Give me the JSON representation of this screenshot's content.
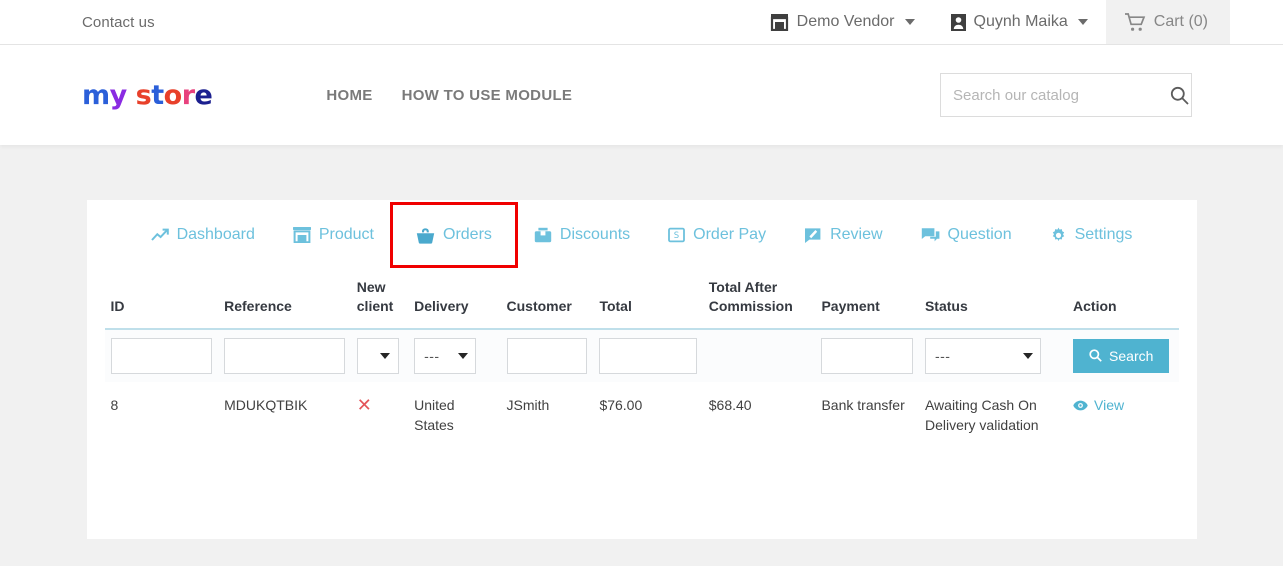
{
  "topbar": {
    "contact": "Contact us",
    "vendor": "Demo Vendor",
    "account": "Quynh Maika",
    "cart": "Cart (0)"
  },
  "header": {
    "logo": [
      {
        "char": "m",
        "color": "#2b5fd9"
      },
      {
        "char": "y",
        "color": "#8a2be2"
      },
      {
        "char": " ",
        "color": "#ffffff"
      },
      {
        "char": "s",
        "color": "#e8402a"
      },
      {
        "char": "t",
        "color": "#2b5fd9"
      },
      {
        "char": "o",
        "color": "#e8402a"
      },
      {
        "char": "r",
        "color": "#e8417d"
      },
      {
        "char": "e",
        "color": "#1b1f8f"
      }
    ],
    "logo_text": "my store",
    "nav": [
      {
        "label": "HOME",
        "name": "nav-home"
      },
      {
        "label": "HOW TO USE MODULE",
        "name": "nav-how-to-use-module"
      }
    ],
    "search": {
      "placeholder": "Search our catalog",
      "value": ""
    }
  },
  "tabs": [
    {
      "label": "Dashboard",
      "icon": "trending-up-icon",
      "active": false
    },
    {
      "label": "Product",
      "icon": "store-icon",
      "active": false
    },
    {
      "label": "Orders",
      "icon": "basket-icon",
      "active": true
    },
    {
      "label": "Discounts",
      "icon": "tag-icon",
      "active": false
    },
    {
      "label": "Order Pay",
      "icon": "money-bill-icon",
      "active": false
    },
    {
      "label": "Review",
      "icon": "pencil-square-icon",
      "active": false
    },
    {
      "label": "Question",
      "icon": "chat-bubbles-icon",
      "active": false
    },
    {
      "label": "Settings",
      "icon": "gear-icon",
      "active": false
    }
  ],
  "table": {
    "headers": [
      "ID",
      "Reference",
      "New client",
      "Delivery",
      "Customer",
      "Total",
      "Total After Commission",
      "Payment",
      "Status",
      "Action"
    ],
    "filters": {
      "id": "",
      "reference": "",
      "new_client": "",
      "delivery": "---",
      "customer": "",
      "total": "",
      "payment": "",
      "status": "---",
      "search_label": "Search"
    },
    "rows": [
      {
        "id": "8",
        "reference": "MDUKQTBIK",
        "new_client": "✕",
        "delivery": "United States",
        "customer": "JSmith",
        "total": "$76.00",
        "total_after_commission": "$68.40",
        "payment": "Bank transfer",
        "status": "Awaiting Cash On Delivery validation",
        "action": "View"
      }
    ]
  },
  "colors": {
    "accent": "#4fb3d0",
    "tab_text": "#6dc1dd",
    "highlight_box": "#f00000",
    "x_mark": "#e4545a",
    "page_bg": "#f1f1f1"
  }
}
